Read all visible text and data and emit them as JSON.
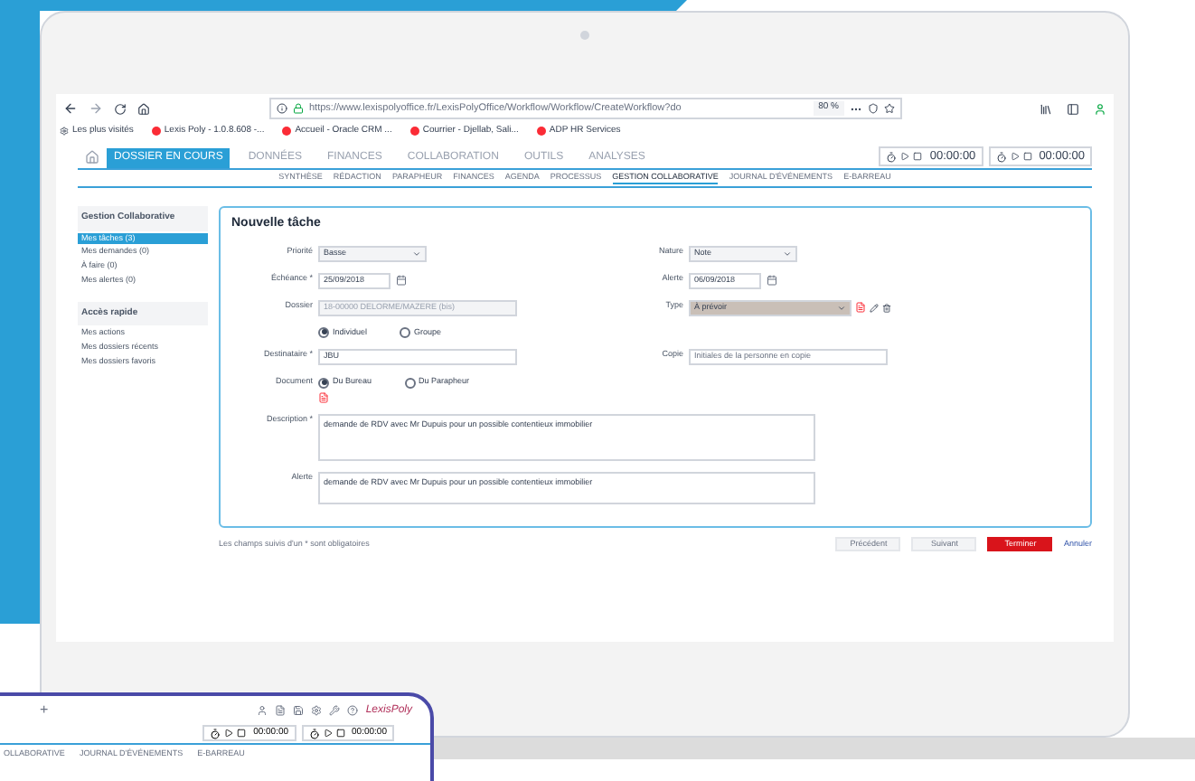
{
  "browser": {
    "url": "https://www.lexispolyoffice.fr/LexisPolyOffice/Workflow/Workflow/CreateWorkflow?do",
    "zoom": "80 %",
    "bookmarks": [
      "Les plus visités",
      "Lexis Poly - 1.0.8.608 -...",
      "Accueil - Oracle CRM ...",
      "Courrier - Djellab, Sali...",
      "ADP HR Services"
    ]
  },
  "main_tabs": [
    {
      "label": "DOSSIER EN COURS",
      "selected": true
    },
    {
      "label": "DONNÉES",
      "selected": false
    },
    {
      "label": "FINANCES",
      "selected": false
    },
    {
      "label": "COLLABORATION",
      "selected": false
    },
    {
      "label": "OUTILS",
      "selected": false
    },
    {
      "label": "ANALYSES",
      "selected": false
    }
  ],
  "timers": [
    "00:00:00",
    "00:00:00"
  ],
  "sub_tabs": [
    {
      "label": "SYNTHÈSE",
      "selected": false
    },
    {
      "label": "RÉDACTION",
      "selected": false
    },
    {
      "label": "PARAPHEUR",
      "selected": false
    },
    {
      "label": "FINANCES",
      "selected": false
    },
    {
      "label": "AGENDA",
      "selected": false
    },
    {
      "label": "PROCESSUS",
      "selected": false
    },
    {
      "label": "GESTION COLLABORATIVE",
      "selected": true
    },
    {
      "label": "JOURNAL D'ÉVÉNEMENTS",
      "selected": false
    },
    {
      "label": "E-BARREAU",
      "selected": false
    }
  ],
  "sidebar": [
    {
      "title": "Gestion Collaborative",
      "items": [
        {
          "label": "Mes tâches (3)",
          "selected": true
        },
        {
          "label": "Mes demandes (0)",
          "selected": false
        },
        {
          "label": "À faire (0)",
          "selected": false
        },
        {
          "label": "Mes alertes (0)",
          "selected": false
        }
      ]
    },
    {
      "title": "Accès rapide",
      "items": [
        {
          "label": "Mes actions",
          "selected": false
        },
        {
          "label": "Mes dossiers récents",
          "selected": false
        },
        {
          "label": "Mes dossiers favoris",
          "selected": false
        }
      ]
    }
  ],
  "form": {
    "title": "Nouvelle tâche",
    "rows": [
      [
        {
          "kind": "select",
          "label": "Priorité",
          "value": "Basse"
        },
        {
          "kind": "select",
          "label": "Nature",
          "value": "Note"
        }
      ],
      [
        {
          "kind": "date",
          "label": "Échéance *",
          "value": "25/09/2018"
        },
        {
          "kind": "date",
          "label": "Alerte",
          "value": "06/09/2018"
        }
      ],
      [
        {
          "kind": "text",
          "label": "Dossier",
          "value": "18-00000 DELORME/MAZERE (bis)",
          "disabled": true
        },
        {
          "kind": "type",
          "label": "Type",
          "value": "À prévoir"
        }
      ],
      [
        {
          "kind": "radio",
          "options": [
            {
              "label": "Individuel",
              "selected": true
            },
            {
              "label": "Groupe",
              "selected": false
            }
          ]
        }
      ],
      [
        {
          "kind": "text",
          "label": "Destinataire *",
          "value": "JBU",
          "disabled": false
        },
        {
          "kind": "text",
          "label": "Copie",
          "placeholder": "Initiales de la personne en copie",
          "disabled": false
        }
      ],
      [
        {
          "kind": "radio",
          "label": "Document",
          "file": true,
          "options": [
            {
              "label": "Du Bureau",
              "selected": true
            },
            {
              "label": "Du Parapheur",
              "selected": false
            }
          ]
        }
      ],
      [
        {
          "kind": "textarea",
          "label": "Description *",
          "value": "demande de RDV avec Mr Dupuis pour un possible contentieux immobilier",
          "tall": true
        }
      ],
      [
        {
          "kind": "textarea",
          "label": "Alerte",
          "value": "demande de RDV avec Mr Dupuis pour un possible contentieux immobilier",
          "tall": false
        }
      ]
    ],
    "note": "Les champs suivis d'un * sont obligatoires",
    "buttons": [
      {
        "kind": "plain",
        "label": "Précédent"
      },
      {
        "kind": "plain",
        "label": "Suivant"
      },
      {
        "kind": "primary",
        "label": "Terminer"
      },
      {
        "kind": "link",
        "label": "Annuler"
      }
    ]
  },
  "popup": {
    "new_tab": "+",
    "logo": "LexisPoly",
    "timers": [
      "00:00:00",
      "00:00:00"
    ],
    "tabs": [
      "OLLABORATIVE",
      "JOURNAL D'ÉVÉNEMENTS",
      "E-BARREAU"
    ]
  }
}
